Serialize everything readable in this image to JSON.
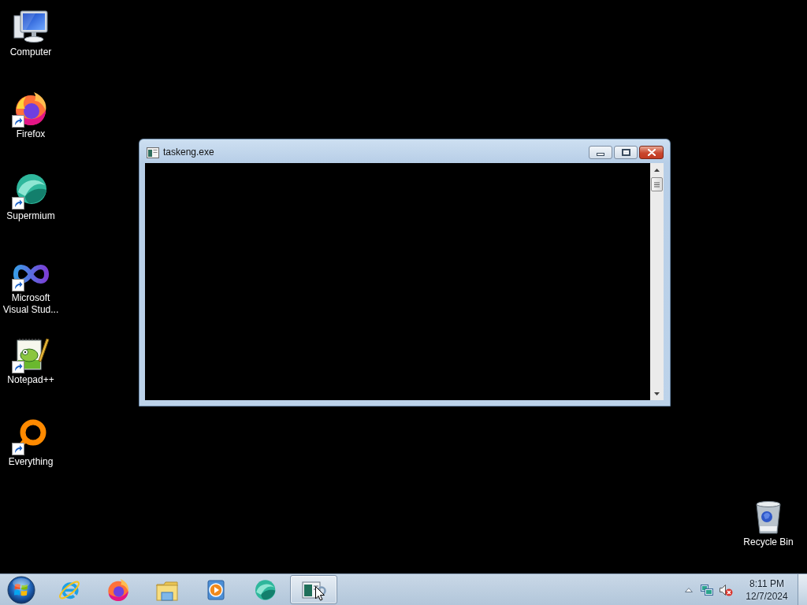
{
  "desktop": {
    "icons": [
      {
        "label": "Computer",
        "shortcut": false
      },
      {
        "label": "Firefox",
        "shortcut": true
      },
      {
        "label": "Supermium",
        "shortcut": true
      },
      {
        "label": "Microsoft Visual Stud...",
        "shortcut": true
      },
      {
        "label": "Notepad++",
        "shortcut": true
      },
      {
        "label": "Everything",
        "shortcut": true
      }
    ],
    "recycle_bin": {
      "label": "Recycle Bin"
    }
  },
  "window": {
    "title": "taskeng.exe"
  },
  "taskbar": {
    "buttons": [
      {
        "selected": false
      },
      {
        "selected": false
      },
      {
        "selected": false
      },
      {
        "selected": false
      },
      {
        "selected": false
      },
      {
        "selected": true
      }
    ],
    "tray": {
      "volume_muted": true,
      "time": "8:11 PM",
      "date": "12/7/2024"
    }
  }
}
